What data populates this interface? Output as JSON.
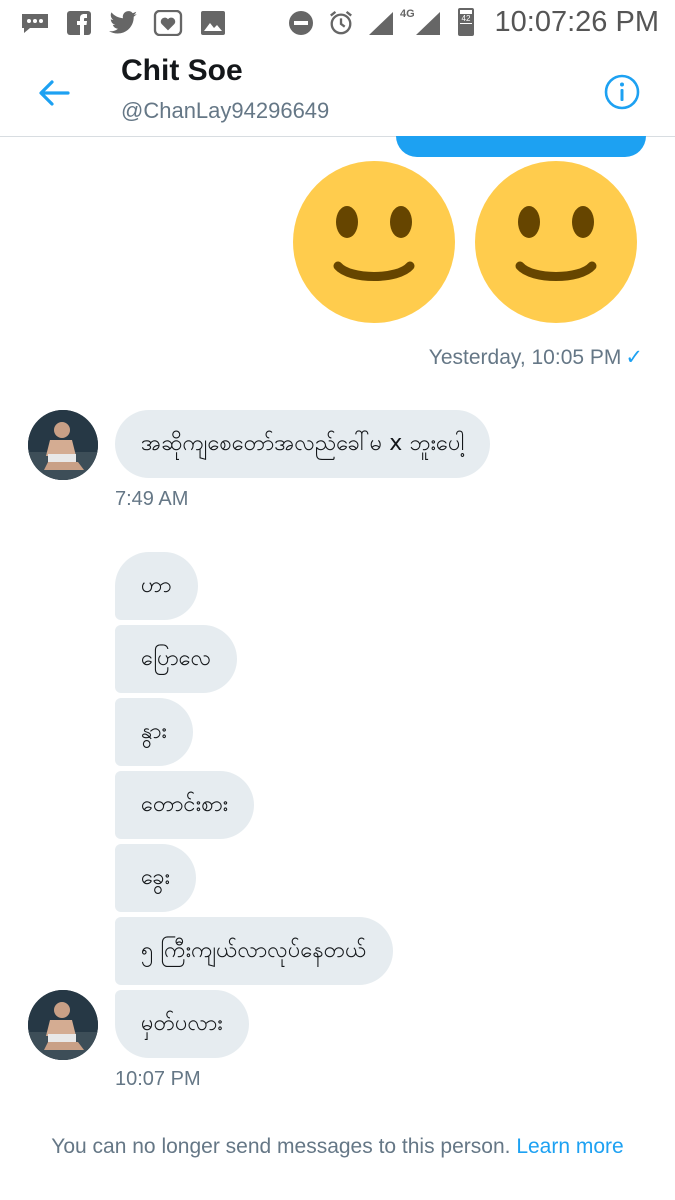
{
  "status_bar": {
    "time": "10:07:26 PM",
    "network": "4G",
    "battery": "42",
    "icons": [
      "messages-icon",
      "facebook-icon",
      "twitter-icon",
      "heart-app-icon",
      "gallery-icon",
      "dnd-icon",
      "alarm-icon",
      "signal-icon",
      "signal-icon",
      "battery-icon"
    ]
  },
  "header": {
    "name": "Chit Soe",
    "handle": "@ChanLay94296649",
    "back_icon": "back-arrow-icon",
    "info_icon": "info-icon"
  },
  "sent": {
    "emojis": [
      "🙂",
      "🙂"
    ],
    "timestamp": "Yesterday, 10:05 PM",
    "status": "✓"
  },
  "received_1": {
    "text": "အဆိုကျစေတော်အလည်ခေါ်မ x ဘူးပေါ့",
    "time": "7:49 AM"
  },
  "received_2": {
    "messages": [
      "ဟာ",
      "ပြောလေ",
      "နွား",
      "တောင်းစား",
      "ခွေး",
      "၅ ကြီးကျယ်လာလုပ်နေတယ်",
      "မှတ်ပလား"
    ],
    "time": "10:07 PM"
  },
  "footer": {
    "note": "You can no longer send messages to this person.",
    "link": "Learn more"
  },
  "colors": {
    "accent": "#1da1f2",
    "bubble": "#e6ecf0",
    "secondary_text": "#657786"
  }
}
